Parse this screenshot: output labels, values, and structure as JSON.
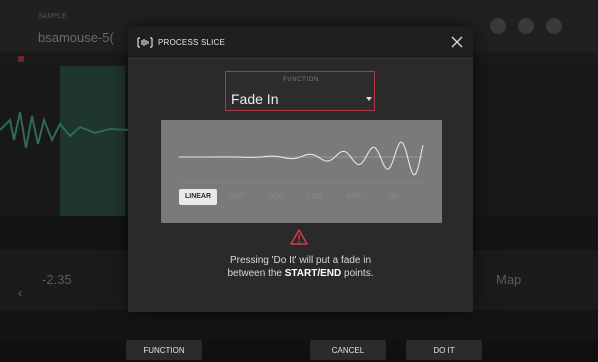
{
  "background": {
    "title": "bsamouse-5(",
    "small_label": "SAMPLE",
    "value_left": "-2.35",
    "value_right": "Map"
  },
  "dialog": {
    "title": "PROCESS SLICE",
    "function_label": "FUNCTION",
    "function_value": "Fade In",
    "curve_options": [
      {
        "label": "LINEAR",
        "active": true
      },
      {
        "label": "SQRT",
        "active": false
      },
      {
        "label": "SQR",
        "active": false
      },
      {
        "label": "LOG",
        "active": false
      },
      {
        "label": "EXP",
        "active": false
      },
      {
        "label": "SIN",
        "active": false
      }
    ],
    "message_part1": "Pressing 'Do It' will put a fade in",
    "message_part2": "between the ",
    "message_bold": "START/END",
    "message_part3": " points."
  },
  "footer": {
    "function": "FUNCTION",
    "cancel": "CANCEL",
    "do_it": "DO IT"
  },
  "colors": {
    "accent": "#b3374a",
    "warning": "#e03a4a",
    "slice_bg": "#1f3a2f"
  }
}
